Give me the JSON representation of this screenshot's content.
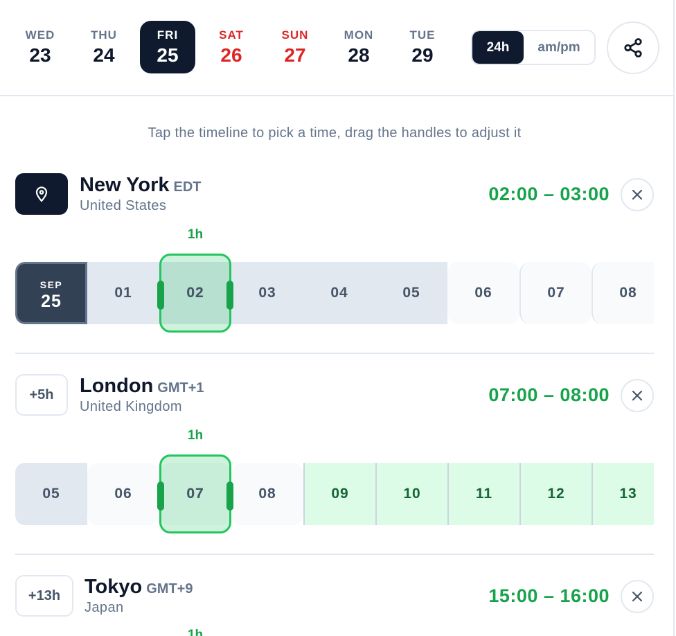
{
  "days": [
    {
      "dow": "WED",
      "num": "23"
    },
    {
      "dow": "THU",
      "num": "24"
    },
    {
      "dow": "FRI",
      "num": "25"
    },
    {
      "dow": "SAT",
      "num": "26"
    },
    {
      "dow": "SUN",
      "num": "27"
    },
    {
      "dow": "MON",
      "num": "28"
    },
    {
      "dow": "TUE",
      "num": "29"
    }
  ],
  "selected_day": "FRI 25",
  "time_format": {
    "option_24h": "24h",
    "option_ampm": "am/pm",
    "active": "24h"
  },
  "hint": "Tap the timeline to pick a time, drag the handles to adjust it",
  "cities": [
    {
      "name": "New York",
      "tz": "EDT",
      "country": "United States",
      "badge_icon": "location-pin-icon",
      "range": "02:00 – 03:00",
      "duration": "1h",
      "date_cell": {
        "month": "SEP",
        "day": "25"
      },
      "hours": [
        "01",
        "02",
        "03",
        "04",
        "05",
        "06",
        "07",
        "08"
      ]
    },
    {
      "name": "London",
      "tz": "GMT+1",
      "country": "United Kingdom",
      "badge": "+5h",
      "range": "07:00 – 08:00",
      "duration": "1h",
      "hours": [
        "05",
        "06",
        "07",
        "08",
        "09",
        "10",
        "11",
        "12",
        "13"
      ]
    },
    {
      "name": "Tokyo",
      "tz": "GMT+9",
      "country": "Japan",
      "badge": "+13h",
      "range": "15:00 – 16:00",
      "duration": "1h"
    }
  ],
  "colors": {
    "accent_green": "#16a34a",
    "weekend_red": "#dc2626",
    "dark": "#0f1a2e"
  }
}
